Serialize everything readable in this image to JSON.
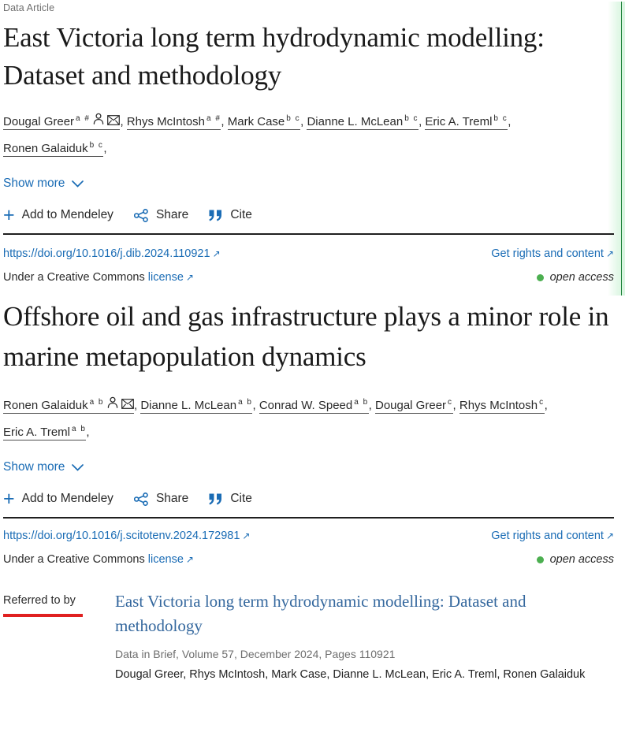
{
  "rail": {
    "accent_color": "#1a7f37",
    "tint_color": "#d8f5e0"
  },
  "articles": [
    {
      "kicker": "Data Article",
      "title": "East Victoria long term hydrodynamic modelling: Dataset and methodology",
      "authors": [
        {
          "name": "Dougal Greer",
          "sup": "a #",
          "has_person_icon": true,
          "has_envelope_icon": true
        },
        {
          "name": "Rhys McIntosh",
          "sup": "a #",
          "has_person_icon": false,
          "has_envelope_icon": false
        },
        {
          "name": "Mark Case",
          "sup": "b c",
          "has_person_icon": false,
          "has_envelope_icon": false
        },
        {
          "name": "Dianne L. McLean",
          "sup": "b c",
          "has_person_icon": false,
          "has_envelope_icon": false
        },
        {
          "name": "Eric A. Treml",
          "sup": "b c",
          "has_person_icon": false,
          "has_envelope_icon": false
        },
        {
          "name": "Ronen Galaiduk",
          "sup": "b c",
          "has_person_icon": false,
          "has_envelope_icon": false
        }
      ],
      "show_more": "Show more",
      "actions": {
        "mendeley": "Add to Mendeley",
        "share": "Share",
        "cite": "Cite"
      },
      "doi": "https://doi.org/10.1016/j.dib.2024.110921",
      "rights": "Get rights and content",
      "license_prefix": "Under a Creative Commons",
      "license_link": "license",
      "open_access": "open access"
    },
    {
      "kicker": "",
      "title": "Offshore oil and gas infrastructure plays a minor role in marine metapopulation dynamics",
      "authors": [
        {
          "name": "Ronen Galaiduk",
          "sup": "a b",
          "has_person_icon": true,
          "has_envelope_icon": true
        },
        {
          "name": "Dianne L. McLean",
          "sup": "a b",
          "has_person_icon": false,
          "has_envelope_icon": false
        },
        {
          "name": "Conrad W. Speed",
          "sup": "a b",
          "has_person_icon": false,
          "has_envelope_icon": false
        },
        {
          "name": "Dougal Greer",
          "sup": "c",
          "has_person_icon": false,
          "has_envelope_icon": false
        },
        {
          "name": "Rhys McIntosh",
          "sup": "c",
          "has_person_icon": false,
          "has_envelope_icon": false
        },
        {
          "name": "Eric A. Treml",
          "sup": "a b",
          "has_person_icon": false,
          "has_envelope_icon": false
        }
      ],
      "show_more": "Show more",
      "actions": {
        "mendeley": "Add to Mendeley",
        "share": "Share",
        "cite": "Cite"
      },
      "doi": "https://doi.org/10.1016/j.scitotenv.2024.172981",
      "rights": "Get rights and content",
      "license_prefix": "Under a Creative Commons",
      "license_link": "license",
      "open_access": "open access"
    }
  ],
  "referred_to_by": {
    "label": "Referred to by",
    "title": "East Victoria long term hydrodynamic modelling: Dataset and methodology",
    "meta": "Data in Brief, Volume 57, December 2024, Pages 110921",
    "authors": "Dougal Greer, Rhys McIntosh, Mark Case, Dianne L. McLean, Eric A. Treml, Ronen Galaiduk"
  },
  "icons": {
    "person": "person-icon",
    "envelope": "envelope-icon",
    "chevron_down": "chevron-down-icon",
    "plus": "plus-icon",
    "share": "share-icon",
    "quote": "quote-icon",
    "external_link": "external-link-icon",
    "open_access_dot": "open-access-dot-icon"
  }
}
